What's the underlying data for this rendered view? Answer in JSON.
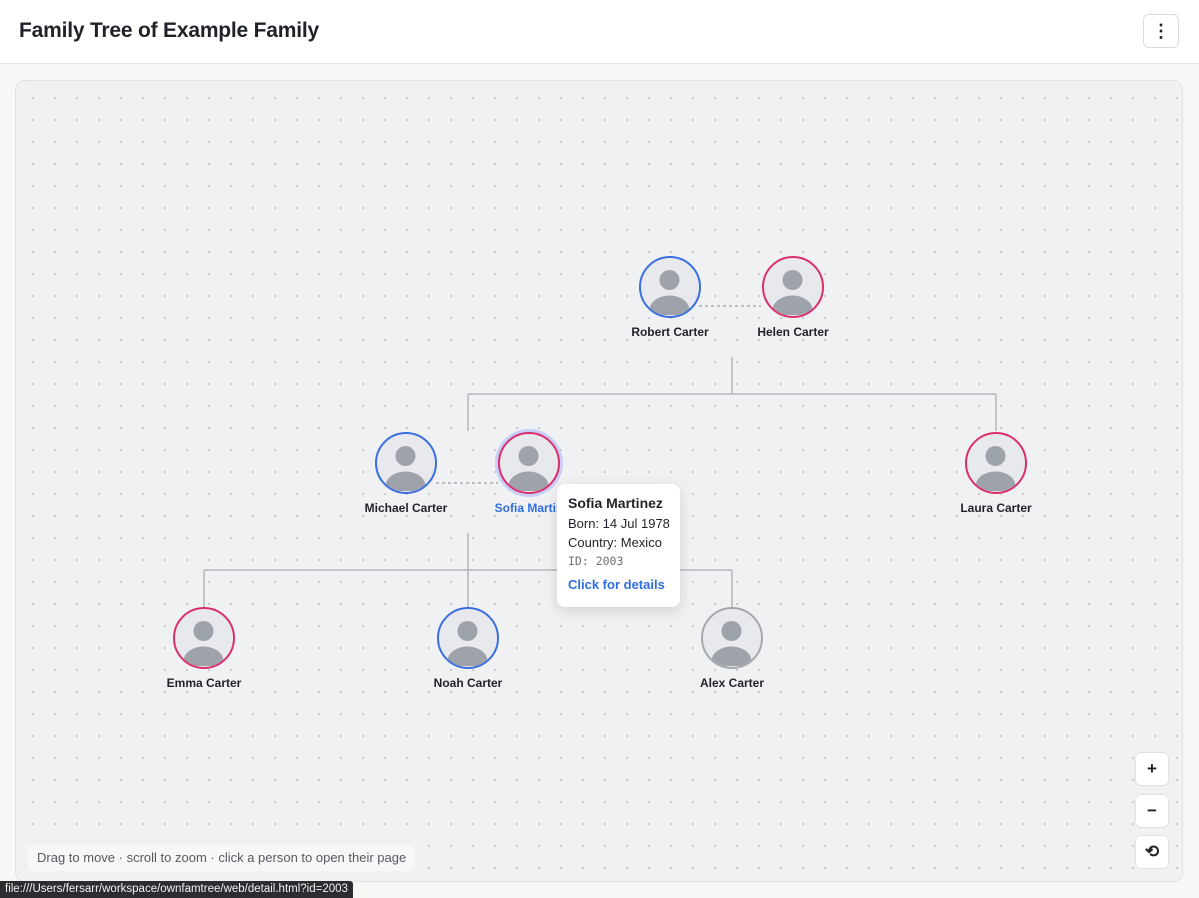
{
  "header": {
    "title": "Family Tree of Example Family",
    "menu_icon": "more-vertical-icon",
    "menu_glyph": "⋮"
  },
  "colors": {
    "male": "#3a6fe0",
    "female": "#db2f6c",
    "unknown": "#a4a7ae",
    "link": "#2f6ee0"
  },
  "people": [
    {
      "name": "Robert Carter",
      "gender": "male"
    },
    {
      "name": "Helen Carter",
      "gender": "female"
    },
    {
      "name": "Michael Carter",
      "gender": "male"
    },
    {
      "name": "Sofia Martinez",
      "display_name": "Sofia Martin",
      "gender": "female",
      "selected": true
    },
    {
      "name": "Laura Carter",
      "gender": "female"
    },
    {
      "name": "Emma Carter",
      "gender": "female"
    },
    {
      "name": "Noah Carter",
      "gender": "male"
    },
    {
      "name": "Alex Carter",
      "gender": "unknown"
    }
  ],
  "tooltip": {
    "name": "Sofia Martinez",
    "born": "Born: 14 Jul 1978",
    "country": "Country: Mexico",
    "id": "ID: 2003",
    "link": "Click for details"
  },
  "controls": {
    "zoom_in": "+",
    "zoom_out": "−",
    "reset_icon": "reset-view-icon",
    "reset_glyph": "⟲"
  },
  "hint": "Drag to move · scroll to zoom · click a person to open their page",
  "status_url": "file:///Users/fersarr/workspace/ownfamtree/web/detail.html?id=2003"
}
